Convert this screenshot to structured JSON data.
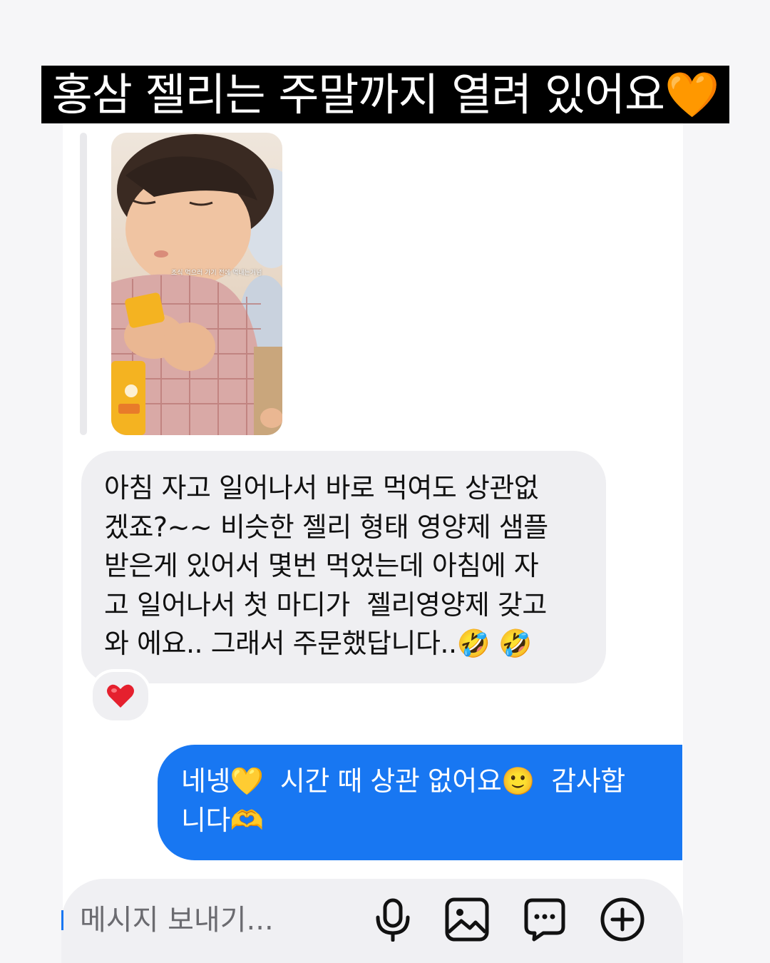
{
  "banner": {
    "title": "홍삼 젤리는 주말까지 열려 있어요🧡"
  },
  "story": {
    "caption": "조식 먹으러 가기 전에 먹내는거넘"
  },
  "messages": {
    "incoming": {
      "text": "아침 자고 일어나서 바로 먹여도 상관없\n겠죠?~~ 비슷한 젤리 형태 영양제 샘플\n받은게 있어서 몇번 먹었는데 아침에 자\n고 일어나서 첫 마디가  젤리영양제 갖고\n와 에요.. 그래서 주문했답니다..🤣 🤣",
      "reaction": "❤️"
    },
    "outgoing": {
      "text": "네넹💛  시간 때 상관 없어요🙂  감사합\n니다🫶"
    }
  },
  "composer": {
    "placeholder": "메시지 보내기...",
    "icons": [
      "microphone-icon",
      "image-icon",
      "sticker-icon",
      "plus-icon"
    ]
  },
  "colors": {
    "outgoing_bubble": "#1877f2",
    "incoming_bubble": "#efeff2",
    "banner_bg": "#000000"
  }
}
